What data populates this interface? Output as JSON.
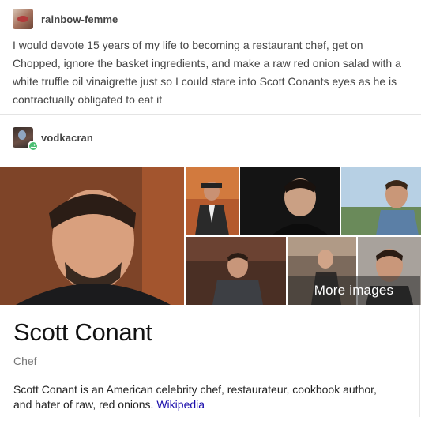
{
  "posts": [
    {
      "username": "rainbow-femme",
      "avatar_icon": "user-avatar-icon",
      "body": "I would devote 15 years of my life to becoming a restaurant chef, get on Chopped, ignore the basket ingredients, and make a raw red onion salad with a white truffle oil vinaigrette just so I could stare into Scott Conants eyes as he is contractually obligated to eat it"
    },
    {
      "username": "vodkacran",
      "avatar_icon": "user-avatar-icon",
      "badge_icon": "reblog-badge-icon"
    }
  ],
  "knowledge_panel": {
    "more_images_label": "More images",
    "title": "Scott Conant",
    "subtitle": "Chef",
    "description": "Scott Conant is an American celebrity chef, restaurateur, cookbook author, and hater of raw, red onions.",
    "source_link": "Wikipedia"
  },
  "colors": {
    "text": "#444444",
    "link": "#1a0dab",
    "badge": "#4bbf73",
    "divider": "#e4e4e4"
  }
}
